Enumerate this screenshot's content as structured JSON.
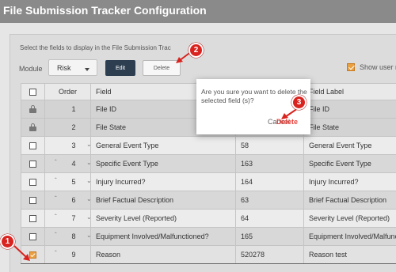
{
  "page": {
    "title": "File Submission Tracker Configuration",
    "instruction": "Select the fields to display in the File Submission Trac"
  },
  "toolbar": {
    "module_label": "Module",
    "module_value": "Risk",
    "edit_label": "Edit",
    "delete_label": "Delete",
    "show_user_label": "Show user r"
  },
  "table": {
    "headers": [
      "",
      "Order",
      "Field",
      "",
      "Field Label"
    ],
    "rows": [
      {
        "order": "1",
        "field": "File ID",
        "id": "",
        "label": "File ID"
      },
      {
        "order": "2",
        "field": "File State",
        "id": "",
        "label": "File State"
      },
      {
        "order": "3",
        "field": "General Event Type",
        "id": "58",
        "label": "General Event Type"
      },
      {
        "order": "4",
        "field": "Specific Event Type",
        "id": "163",
        "label": "Specific Event Type"
      },
      {
        "order": "5",
        "field": "Injury Incurred?",
        "id": "164",
        "label": "Injury Incurred?"
      },
      {
        "order": "6",
        "field": "Brief Factual Description",
        "id": "63",
        "label": "Brief Factual Description"
      },
      {
        "order": "7",
        "field": "Severity Level (Reported)",
        "id": "64",
        "label": "Severity Level (Reported)"
      },
      {
        "order": "8",
        "field": "Equipment Involved/Malfunctioned?",
        "id": "165",
        "label": "Equipment Involved/Malfunct"
      },
      {
        "order": "9",
        "field": "Reason",
        "id": "520278",
        "label": "Reason test"
      }
    ]
  },
  "dialog": {
    "message": "Are you sure you want to delete the selected field (s)?",
    "cancel_label": "Cancel",
    "delete_label": "Delete"
  },
  "markers": [
    "1",
    "2",
    "3"
  ],
  "colors": {
    "accent": "#e8a040",
    "marker": "#d9231f",
    "edit_button": "#2c3e50",
    "danger": "#e8443f"
  }
}
